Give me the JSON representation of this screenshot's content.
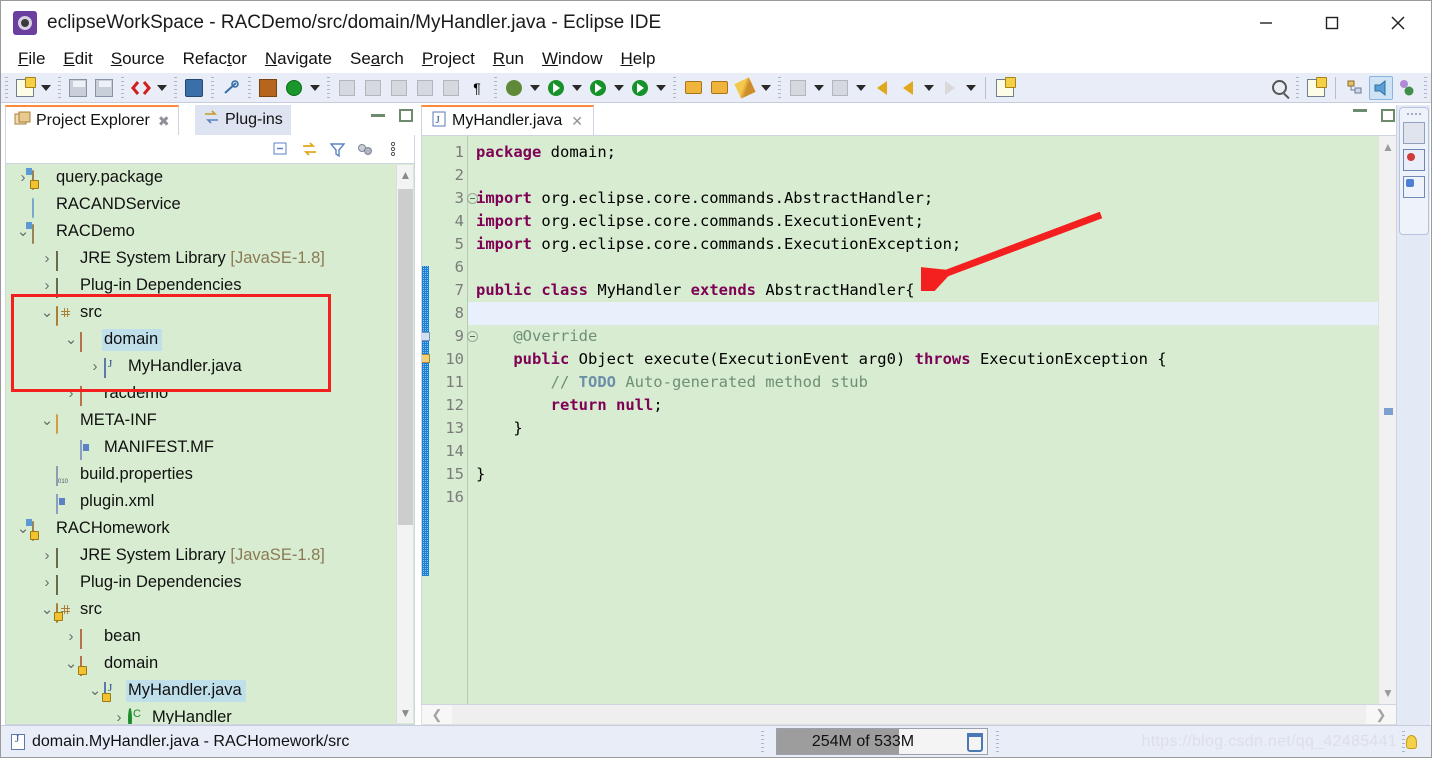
{
  "window": {
    "title": "eclipseWorkSpace - RACDemo/src/domain/MyHandler.java - Eclipse IDE",
    "minimize": "—",
    "maximize": "□",
    "close": "✕"
  },
  "menu": [
    {
      "label": "File"
    },
    {
      "label": "Edit"
    },
    {
      "label": "Source"
    },
    {
      "label": "Refactor"
    },
    {
      "label": "Navigate"
    },
    {
      "label": "Search"
    },
    {
      "label": "Project"
    },
    {
      "label": "Run"
    },
    {
      "label": "Window"
    },
    {
      "label": "Help"
    }
  ],
  "toolbar": {
    "icons": [
      "new-wizard-icon",
      "save-icon",
      "save-all-icon",
      "open-type-icon",
      "console-icon",
      "skip-breakpoints-icon",
      "new-plugin-icon",
      "refresh-icon",
      "search-type-icon",
      "clean-icon",
      "link-icon",
      "export-icon",
      "properties-icon",
      "paragraph-icon",
      "debug-icon",
      "run-icon",
      "run-config-icon",
      "coverage-icon",
      "open-folder-icon",
      "open-resource-icon",
      "pencil-icon",
      "next-annotation-icon",
      "prev-annotation-icon",
      "last-edit-icon",
      "back-icon",
      "forward-icon",
      "new-window-icon"
    ],
    "right_icons": [
      "search-icon",
      "new-perspective-icon",
      "java-perspective-icon",
      "debug-perspective-icon",
      "plugin-perspective-icon"
    ]
  },
  "left_panel": {
    "tabs": [
      {
        "label": "Project Explorer",
        "icon": "project-explorer-icon",
        "active": true,
        "closable": true
      },
      {
        "label": "Plug-ins",
        "icon": "plugins-icon",
        "active": false,
        "closable": false
      }
    ],
    "view_toolbar": [
      "collapse-all-icon",
      "link-with-editor-icon",
      "view-filter-icon",
      "focus-icon",
      "view-menu-icon"
    ],
    "panel_buttons": [
      "minimize-icon",
      "maximize-icon"
    ],
    "tree": [
      {
        "indent": 0,
        "twisty": ">",
        "icon": "java-project-icon",
        "warn": true,
        "label": "query.package",
        "dim": ""
      },
      {
        "indent": 0,
        "twisty": "",
        "icon": "closed-project-icon",
        "warn": false,
        "label": "RACANDService",
        "dim": ""
      },
      {
        "indent": 0,
        "twisty": "v",
        "icon": "java-project-icon",
        "warn": false,
        "label": "RACDemo",
        "dim": ""
      },
      {
        "indent": 1,
        "twisty": ">",
        "icon": "library-icon",
        "warn": false,
        "label": "JRE System Library ",
        "dim": "[JavaSE-1.8]"
      },
      {
        "indent": 1,
        "twisty": ">",
        "icon": "library-icon",
        "warn": false,
        "label": "Plug-in Dependencies",
        "dim": ""
      },
      {
        "indent": 1,
        "twisty": "v",
        "icon": "source-folder-icon",
        "warn": false,
        "label": "src",
        "dim": ""
      },
      {
        "indent": 2,
        "twisty": "v",
        "icon": "package-icon",
        "warn": false,
        "label": "domain",
        "dim": "",
        "selected": true
      },
      {
        "indent": 3,
        "twisty": ">",
        "icon": "java-file-icon",
        "warn": false,
        "label": "MyHandler.java",
        "dim": ""
      },
      {
        "indent": 2,
        "twisty": ">",
        "icon": "package-icon",
        "warn": false,
        "label": "racdemo",
        "dim": ""
      },
      {
        "indent": 1,
        "twisty": "v",
        "icon": "folder-icon",
        "warn": false,
        "label": "META-INF",
        "dim": ""
      },
      {
        "indent": 2,
        "twisty": "",
        "icon": "manifest-icon",
        "warn": false,
        "label": "MANIFEST.MF",
        "dim": ""
      },
      {
        "indent": 1,
        "twisty": "",
        "icon": "properties-file-icon",
        "warn": false,
        "label": "build.properties",
        "dim": ""
      },
      {
        "indent": 1,
        "twisty": "",
        "icon": "manifest-icon",
        "warn": false,
        "label": "plugin.xml",
        "dim": ""
      },
      {
        "indent": 0,
        "twisty": "v",
        "icon": "java-project-icon",
        "warn": true,
        "label": "RACHomework",
        "dim": ""
      },
      {
        "indent": 1,
        "twisty": ">",
        "icon": "library-icon",
        "warn": false,
        "label": "JRE System Library ",
        "dim": "[JavaSE-1.8]"
      },
      {
        "indent": 1,
        "twisty": ">",
        "icon": "library-icon",
        "warn": false,
        "label": "Plug-in Dependencies",
        "dim": ""
      },
      {
        "indent": 1,
        "twisty": "v",
        "icon": "source-folder-icon",
        "warn": true,
        "label": "src",
        "dim": ""
      },
      {
        "indent": 2,
        "twisty": ">",
        "icon": "package-icon",
        "warn": false,
        "label": "bean",
        "dim": ""
      },
      {
        "indent": 2,
        "twisty": "v",
        "icon": "package-icon",
        "warn": true,
        "label": "domain",
        "dim": ""
      },
      {
        "indent": 3,
        "twisty": "v",
        "icon": "java-file-icon",
        "warn": true,
        "label": "MyHandler.java",
        "dim": "",
        "selected": true
      },
      {
        "indent": 4,
        "twisty": ">",
        "icon": "class-icon",
        "warn": false,
        "label": "MyHandler",
        "dim": ""
      }
    ]
  },
  "editor": {
    "tab": {
      "label": "MyHandler.java",
      "icon": "java-file-icon",
      "close": "✕"
    },
    "panel_buttons": [
      "restore-icon",
      "maximize-icon"
    ],
    "current_line": 8,
    "lines": [
      {
        "n": 1,
        "fold": false,
        "tokens": [
          {
            "t": "package",
            "c": "kw"
          },
          {
            "t": " domain;",
            "c": "pl"
          }
        ]
      },
      {
        "n": 2,
        "fold": false,
        "tokens": []
      },
      {
        "n": 3,
        "fold": true,
        "tokens": [
          {
            "t": "import",
            "c": "kw"
          },
          {
            "t": " org.eclipse.core.commands.AbstractHandler;",
            "c": "pl"
          }
        ]
      },
      {
        "n": 4,
        "fold": false,
        "tokens": [
          {
            "t": "import",
            "c": "kw"
          },
          {
            "t": " org.eclipse.core.commands.ExecutionEvent;",
            "c": "pl"
          }
        ]
      },
      {
        "n": 5,
        "fold": false,
        "tokens": [
          {
            "t": "import",
            "c": "kw"
          },
          {
            "t": " org.eclipse.core.commands.ExecutionException;",
            "c": "pl"
          }
        ]
      },
      {
        "n": 6,
        "fold": false,
        "tokens": []
      },
      {
        "n": 7,
        "fold": false,
        "tokens": [
          {
            "t": "public",
            "c": "kw"
          },
          {
            "t": " ",
            "c": "pl"
          },
          {
            "t": "class",
            "c": "kw"
          },
          {
            "t": " MyHandler ",
            "c": "pl"
          },
          {
            "t": "extends",
            "c": "kw"
          },
          {
            "t": " AbstractHandler{",
            "c": "pl"
          }
        ]
      },
      {
        "n": 8,
        "fold": false,
        "tokens": []
      },
      {
        "n": 9,
        "fold": true,
        "tokens": [
          {
            "t": "    @Override",
            "c": "an"
          }
        ]
      },
      {
        "n": 10,
        "fold": false,
        "tokens": [
          {
            "t": "    ",
            "c": "pl"
          },
          {
            "t": "public",
            "c": "kw"
          },
          {
            "t": " Object execute(ExecutionEvent arg0) ",
            "c": "pl"
          },
          {
            "t": "throws",
            "c": "kw"
          },
          {
            "t": " ExecutionException {",
            "c": "pl"
          }
        ]
      },
      {
        "n": 11,
        "fold": false,
        "tokens": [
          {
            "t": "        // ",
            "c": "cm"
          },
          {
            "t": "TODO",
            "c": "todo"
          },
          {
            "t": " Auto-generated method stub",
            "c": "cm"
          }
        ]
      },
      {
        "n": 12,
        "fold": false,
        "tokens": [
          {
            "t": "        ",
            "c": "pl"
          },
          {
            "t": "return",
            "c": "kw"
          },
          {
            "t": " ",
            "c": "pl"
          },
          {
            "t": "null",
            "c": "kw"
          },
          {
            "t": ";",
            "c": "pl"
          }
        ]
      },
      {
        "n": 13,
        "fold": false,
        "tokens": [
          {
            "t": "    }",
            "c": "pl"
          }
        ]
      },
      {
        "n": 14,
        "fold": false,
        "tokens": []
      },
      {
        "n": 15,
        "fold": false,
        "tokens": [
          {
            "t": "}",
            "c": "pl"
          }
        ]
      },
      {
        "n": 16,
        "fold": false,
        "tokens": []
      }
    ]
  },
  "right_bar": {
    "icons": [
      "restore-view-icon",
      "problems-view-icon",
      "outline-view-icon"
    ]
  },
  "status": {
    "selection": "domain.MyHandler.java - RACHomework/src",
    "selection_icon": "java-file-icon",
    "heap_used": "254M",
    "heap_of": " of ",
    "heap_total": "533M",
    "heap_percent": 47.6,
    "trash_icon": "trash-icon",
    "watermark": "https://blog.csdn.net/qq_42485441",
    "tip_icon": "lightbulb-icon"
  },
  "annotations": {
    "rect_color": "#f42020",
    "arrow_color": "#f42020"
  }
}
